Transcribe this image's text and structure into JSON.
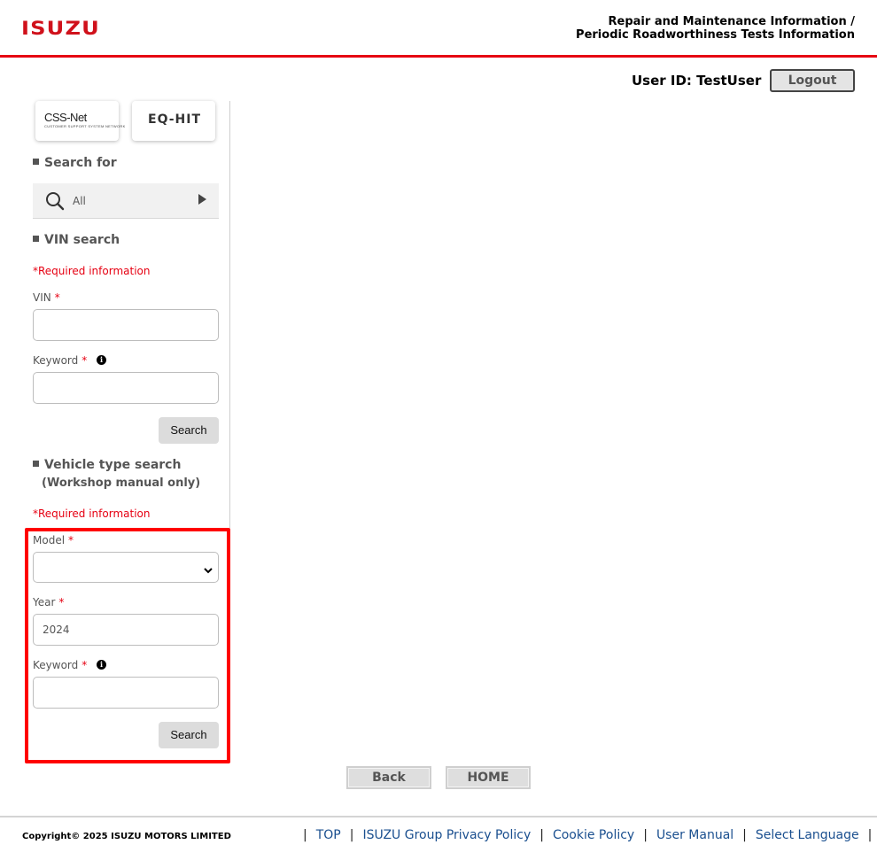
{
  "header": {
    "logo_text": "ISUZU",
    "title_line1": "Repair and Maintenance Information /",
    "title_line2": "Periodic Roadworthiness Tests Information",
    "user_id": "User ID: TestUser",
    "logout_label": "Logout"
  },
  "sidebar": {
    "tiles": {
      "css_net_title": "CSS-Net",
      "css_net_subtitle": "CUSTOMER SUPPORT SYSTEM NETWORK",
      "eq_hit_label": "EQ-HIT"
    },
    "search_for": {
      "heading": "Search for",
      "value": "All"
    },
    "vin_search": {
      "heading": "VIN search",
      "required_note": "*Required information",
      "vin_label": "VIN",
      "vin_value": "",
      "keyword_label": "Keyword",
      "keyword_value": "",
      "search_label": "Search"
    },
    "vehicle_search": {
      "heading": "Vehicle type search",
      "subheading": "(Workshop manual only)",
      "required_note": "*Required information",
      "model_label": "Model",
      "model_value": "",
      "year_label": "Year",
      "year_value": "2024",
      "keyword_label": "Keyword",
      "keyword_value": "",
      "search_label": "Search"
    },
    "required_marker": "*"
  },
  "nav": {
    "back_label": "Back",
    "home_label": "HOME"
  },
  "footer": {
    "copyright": "Copyright© 2025 ISUZU MOTORS LIMITED",
    "separator": "|",
    "links": [
      "TOP",
      "ISUZU Group Privacy Policy",
      "Cookie Policy",
      "User Manual",
      "Select Language"
    ]
  },
  "colors": {
    "brand_red": "#d0111b",
    "rule_red": "#e60012",
    "highlight_red": "#ff0000",
    "link_blue": "#1a4f8f"
  },
  "icons": {
    "search_for": "magnifier-icon",
    "search_for_arrow": "play-arrow-icon",
    "info": "info-icon",
    "select": "chevron-down-icon"
  }
}
